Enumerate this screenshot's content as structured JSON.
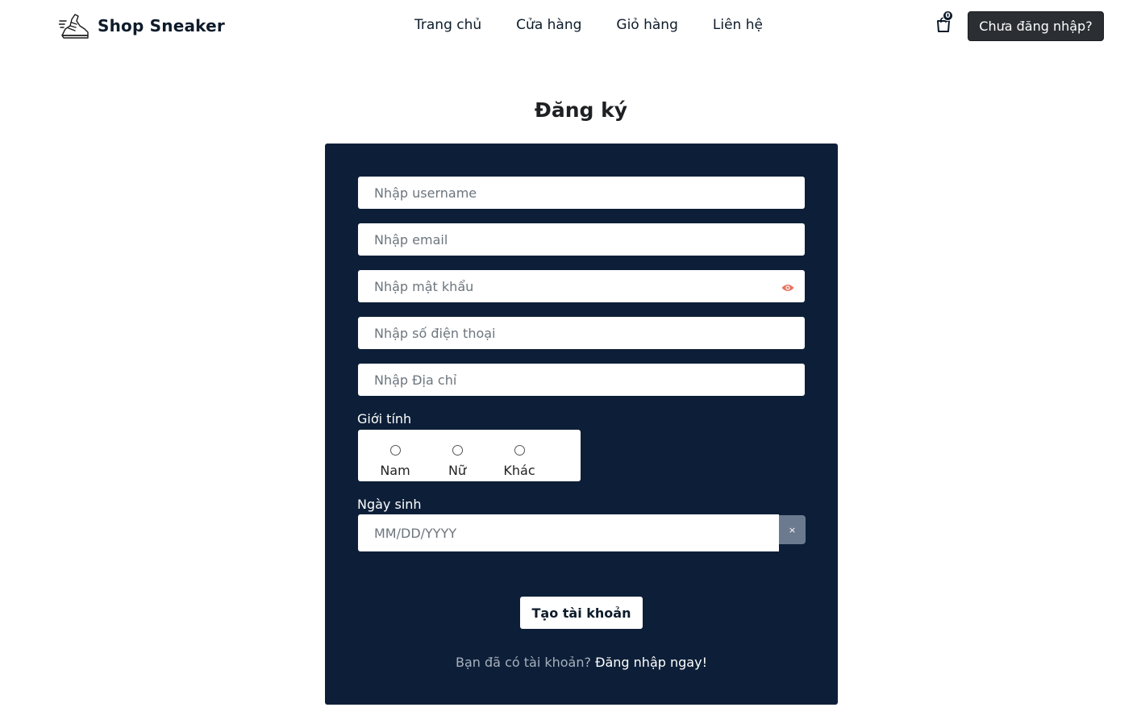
{
  "header": {
    "brand": "Shop Sneaker",
    "nav": [
      "Trang chủ",
      "Cửa hàng",
      "Giỏ hàng",
      "Liên hệ"
    ],
    "cart_count": "0",
    "login_button": "Chưa đăng nhập?"
  },
  "page": {
    "title": "Đăng ký"
  },
  "form": {
    "username_placeholder": "Nhập username",
    "email_placeholder": "Nhập email",
    "password_placeholder": "Nhập mật khẩu",
    "phone_placeholder": "Nhập số điện thoại",
    "address_placeholder": "Nhập Địa chỉ",
    "gender_label": "Giới tính",
    "gender_options": [
      "Nam",
      "Nữ",
      "Khác"
    ],
    "birthday_label": "Ngày sinh",
    "birthday_placeholder": "MM/DD/YYYY",
    "clear_symbol": "×",
    "submit_label": "Tạo tài khoản",
    "have_account_text": "Bạn đã có tài khoản? ",
    "login_link": "Đăng nhập ngay!"
  },
  "colors": {
    "panel": "#0d1f38",
    "eye_icon": "#e8735a",
    "login_button": "#2b2f33"
  }
}
